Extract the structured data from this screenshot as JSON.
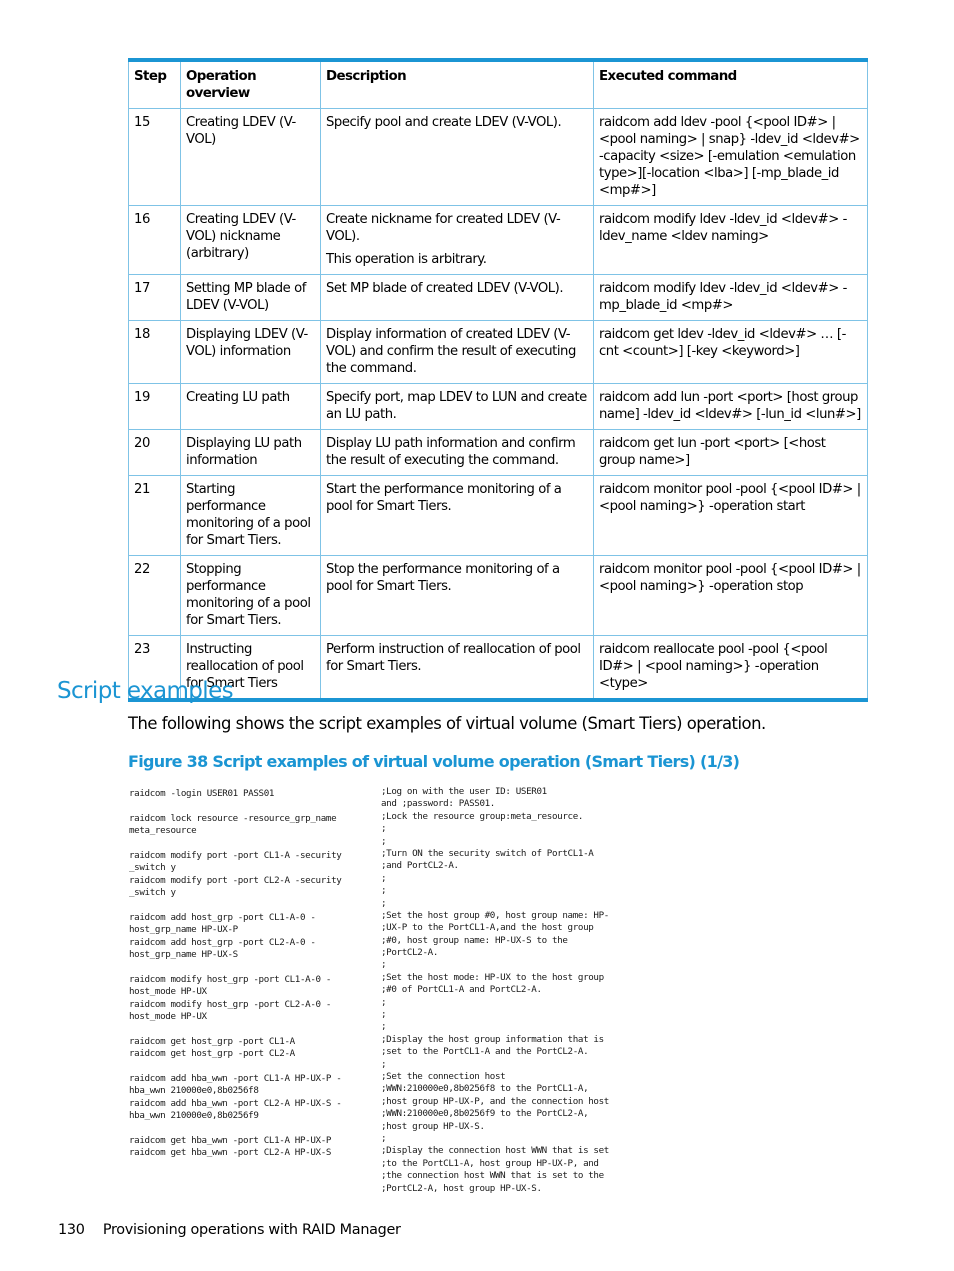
{
  "table": {
    "headers": [
      "Step",
      "Operation overview",
      "Description",
      "Executed command"
    ],
    "rows": [
      {
        "step": "15",
        "overview": "Creating LDEV (V-VOL)",
        "description": [
          "Specify pool and create LDEV (V-VOL)."
        ],
        "command": "raidcom add ldev -pool {<pool ID#> | <pool naming> | snap} -ldev_id <ldev#> -capacity <size> [-emulation <emulation type>][-location <lba>] [-mp_blade_id <mp#>]"
      },
      {
        "step": "16",
        "overview": "Creating LDEV (V-VOL) nickname (arbitrary)",
        "description": [
          "Create nickname for created LDEV (V-VOL).",
          "This operation is arbitrary."
        ],
        "command": "raidcom modify ldev -ldev_id <ldev#> -ldev_name <ldev naming>"
      },
      {
        "step": "17",
        "overview": "Setting MP blade of LDEV (V-VOL)",
        "description": [
          "Set MP blade of created LDEV (V-VOL)."
        ],
        "command": "raidcom modify ldev -ldev_id <ldev#> -mp_blade_id <mp#>"
      },
      {
        "step": "18",
        "overview": "Displaying LDEV (V-VOL) information",
        "description": [
          "Display information of created LDEV (V-VOL) and confirm the result of executing the command."
        ],
        "command": "raidcom get ldev -ldev_id <ldev#> … [-cnt <count>] [-key <keyword>]"
      },
      {
        "step": "19",
        "overview": "Creating LU path",
        "description": [
          "Specify port, map LDEV to LUN and create an LU path."
        ],
        "command": "raidcom add lun -port <port> [host group name] -ldev_id <ldev#> [-lun_id <lun#>]"
      },
      {
        "step": "20",
        "overview": "Displaying LU path information",
        "description": [
          "Display LU path information and confirm the result of executing the command."
        ],
        "command": "raidcom get lun -port <port> [<host group name>]"
      },
      {
        "step": "21",
        "overview": "Starting performance monitoring of a pool for Smart Tiers.",
        "description": [
          "Start the performance monitoring of a pool for Smart Tiers."
        ],
        "command": "raidcom monitor pool -pool {<pool ID#> | <pool naming>} -operation start"
      },
      {
        "step": "22",
        "overview": "Stopping performance monitoring of a pool for Smart Tiers.",
        "description": [
          "Stop the performance monitoring of a pool for Smart Tiers."
        ],
        "command": "raidcom monitor pool -pool {<pool ID#> | <pool naming>} -operation stop"
      },
      {
        "step": "23",
        "overview": "Instructing reallocation of pool for Smart Tiers",
        "description": [
          "Perform instruction of reallocation of pool for Smart Tiers."
        ],
        "command": "raidcom reallocate pool -pool {<pool ID#> | <pool naming>} -operation <type>"
      }
    ]
  },
  "section": {
    "title": "Script examples",
    "intro": "The following shows the script examples of virtual volume (Smart Tiers) operation.",
    "figure_caption": "Figure 38 Script examples of virtual volume operation (Smart Tiers) (1/3)"
  },
  "script": {
    "commands": [
      "raidcom -login USER01 PASS01",
      "",
      "raidcom lock resource -resource_grp_name",
      "meta_resource",
      "",
      "raidcom modify port -port CL1-A -security",
      "_switch y",
      "raidcom modify port -port CL2-A -security",
      "_switch y",
      "",
      "raidcom add host_grp -port CL1-A-0 -",
      "host_grp_name HP-UX-P",
      "raidcom add host_grp -port CL2-A-0 -",
      "host_grp_name HP-UX-S",
      "",
      "raidcom modify host_grp -port CL1-A-0 -",
      "host_mode HP-UX",
      "raidcom modify host_grp -port CL2-A-0 -",
      "host_mode HP-UX",
      "",
      "raidcom get host_grp -port CL1-A",
      "raidcom get host_grp -port CL2-A",
      "",
      "raidcom add hba_wwn -port CL1-A HP-UX-P -",
      "hba_wwn 210000e0,8b0256f8",
      "raidcom add hba_wwn -port CL2-A HP-UX-S -",
      "hba_wwn 210000e0,8b0256f9",
      "",
      "raidcom get hba_wwn -port CL1-A HP-UX-P",
      "raidcom get hba_wwn -port CL2-A HP-UX-S"
    ],
    "comments": [
      ";Log on with the user ID: USER01",
      "and ;password: PASS01.",
      ";Lock the resource group:meta_resource.",
      ";",
      ";",
      ";Turn ON the security switch of PortCL1-A",
      ";and PortCL2-A.",
      ";",
      ";",
      ";",
      ";Set the host group #0, host group name: HP-",
      ";UX-P to the PortCL1-A,and the host group",
      ";#0, host group name: HP-UX-S to the",
      ";PortCL2-A.",
      ";",
      ";Set the host mode: HP-UX to the host group",
      ";#0 of PortCL1-A and PortCL2-A.",
      ";",
      ";",
      ";",
      ";Display the host group information that is",
      ";set to the PortCL1-A and the PortCL2-A.",
      ";",
      ";Set the connection host",
      ";WWN:210000e0,8b0256f8 to the PortCL1-A,",
      ";host group HP-UX-P, and the connection host",
      ";WWN:210000e0,8b0256f9 to the PortCL2-A,",
      ";host group HP-UX-S.",
      ";",
      ";Display the connection host WWN that is set",
      ";to the PortCL1-A, host group HP-UX-P, and",
      ";the connection host WWN that is set to the",
      ";PortCL2-A, host group HP-UX-S."
    ]
  },
  "footer": {
    "page_number": "130",
    "chapter": "Provisioning operations with RAID Manager"
  }
}
